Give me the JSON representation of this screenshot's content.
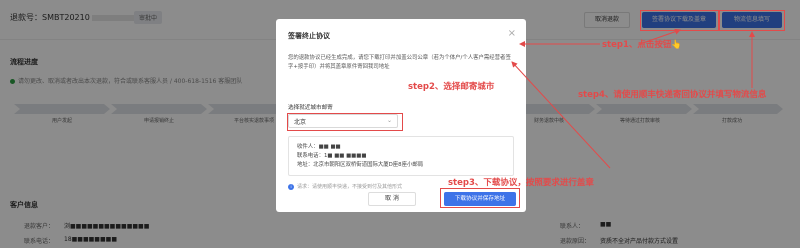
{
  "header": {
    "refund_id": "退款号：SMBT20210",
    "status": "审批中",
    "cancel_refund": "取消退款",
    "sign_download": "签署协议下载及盖章",
    "fill_logistics": "物流信息填写"
  },
  "progress": {
    "title": "流程进度",
    "notice": "请勿更改、取消或者改出本次退款，符合或联系客服人员 / 400-618-1516 客服团队",
    "steps": [
      "用户发起",
      "申请报销终止",
      "平台核实退款事项",
      "回寄退款申请审核完成",
      "等待收寄退款",
      "财务退款中核",
      "等待通过打款审核",
      "打款成功"
    ]
  },
  "customer": {
    "title": "客户信息",
    "rows": [
      {
        "label": "退款客户：",
        "value": "浏■■■■■■■■■■■■■■"
      },
      {
        "label": "联系电话：",
        "value": "18■■■■■■■■"
      }
    ],
    "right_rows": [
      {
        "label": "联系人：",
        "value": "■■"
      },
      {
        "label": "退款原因：",
        "value": "资质不全对产品付款方式设置"
      }
    ]
  },
  "modal": {
    "title": "签署终止协议",
    "description": "您的退款协议已经生成完成，请您下载打印并加盖公司公章（若为个体户/个人客户需经营者签字+按手印）并将其盖章原件寄回我司地址",
    "select_label": "选择就近城市邮寄",
    "select_value": "北京",
    "address": {
      "recipient": "收件人：■■ ■■",
      "phone": "联系电话：1■ ■■ ■■■■",
      "addr": "地址：北京市朝阳区双桥街道国际大厦D座8座小邮局"
    },
    "tip": "请求：请使用顺丰快递，不接受到付及其他形式",
    "cancel": "取 消",
    "download": "下载协议并保存地址"
  },
  "annotations": {
    "step1": "step1、点击按钮👆",
    "step2": "step2、选择邮寄城市",
    "step3": "step3、下载协议，按照要求进行盖章",
    "step4": "step4、请使用顺丰快递寄回协议并填写物流信息"
  },
  "colors": {
    "primary": "#3d73e8",
    "annotation": "#e34a4a"
  }
}
